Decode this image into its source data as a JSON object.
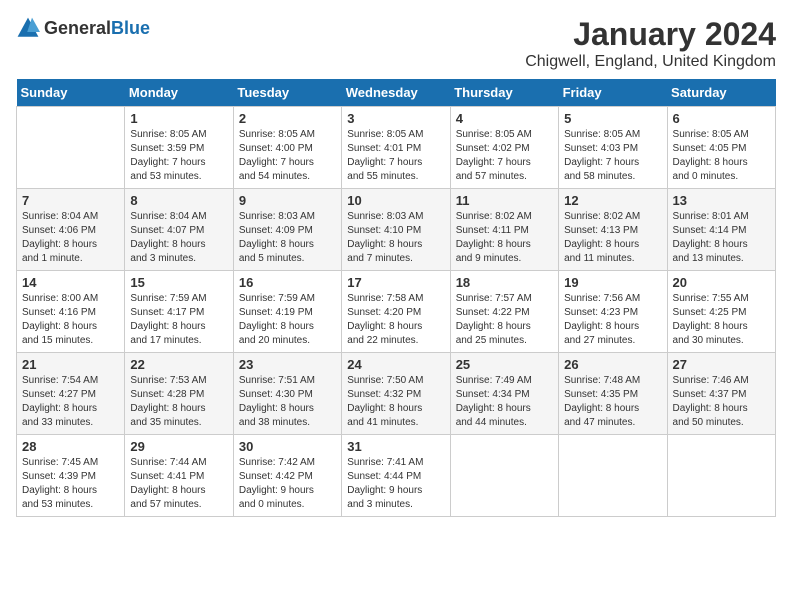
{
  "header": {
    "logo_general": "General",
    "logo_blue": "Blue",
    "title": "January 2024",
    "location": "Chigwell, England, United Kingdom"
  },
  "columns": [
    "Sunday",
    "Monday",
    "Tuesday",
    "Wednesday",
    "Thursday",
    "Friday",
    "Saturday"
  ],
  "weeks": [
    {
      "days": [
        {
          "num": "",
          "info": ""
        },
        {
          "num": "1",
          "info": "Sunrise: 8:05 AM\nSunset: 3:59 PM\nDaylight: 7 hours\nand 53 minutes."
        },
        {
          "num": "2",
          "info": "Sunrise: 8:05 AM\nSunset: 4:00 PM\nDaylight: 7 hours\nand 54 minutes."
        },
        {
          "num": "3",
          "info": "Sunrise: 8:05 AM\nSunset: 4:01 PM\nDaylight: 7 hours\nand 55 minutes."
        },
        {
          "num": "4",
          "info": "Sunrise: 8:05 AM\nSunset: 4:02 PM\nDaylight: 7 hours\nand 57 minutes."
        },
        {
          "num": "5",
          "info": "Sunrise: 8:05 AM\nSunset: 4:03 PM\nDaylight: 7 hours\nand 58 minutes."
        },
        {
          "num": "6",
          "info": "Sunrise: 8:05 AM\nSunset: 4:05 PM\nDaylight: 8 hours\nand 0 minutes."
        }
      ]
    },
    {
      "days": [
        {
          "num": "7",
          "info": "Sunrise: 8:04 AM\nSunset: 4:06 PM\nDaylight: 8 hours\nand 1 minute."
        },
        {
          "num": "8",
          "info": "Sunrise: 8:04 AM\nSunset: 4:07 PM\nDaylight: 8 hours\nand 3 minutes."
        },
        {
          "num": "9",
          "info": "Sunrise: 8:03 AM\nSunset: 4:09 PM\nDaylight: 8 hours\nand 5 minutes."
        },
        {
          "num": "10",
          "info": "Sunrise: 8:03 AM\nSunset: 4:10 PM\nDaylight: 8 hours\nand 7 minutes."
        },
        {
          "num": "11",
          "info": "Sunrise: 8:02 AM\nSunset: 4:11 PM\nDaylight: 8 hours\nand 9 minutes."
        },
        {
          "num": "12",
          "info": "Sunrise: 8:02 AM\nSunset: 4:13 PM\nDaylight: 8 hours\nand 11 minutes."
        },
        {
          "num": "13",
          "info": "Sunrise: 8:01 AM\nSunset: 4:14 PM\nDaylight: 8 hours\nand 13 minutes."
        }
      ]
    },
    {
      "days": [
        {
          "num": "14",
          "info": "Sunrise: 8:00 AM\nSunset: 4:16 PM\nDaylight: 8 hours\nand 15 minutes."
        },
        {
          "num": "15",
          "info": "Sunrise: 7:59 AM\nSunset: 4:17 PM\nDaylight: 8 hours\nand 17 minutes."
        },
        {
          "num": "16",
          "info": "Sunrise: 7:59 AM\nSunset: 4:19 PM\nDaylight: 8 hours\nand 20 minutes."
        },
        {
          "num": "17",
          "info": "Sunrise: 7:58 AM\nSunset: 4:20 PM\nDaylight: 8 hours\nand 22 minutes."
        },
        {
          "num": "18",
          "info": "Sunrise: 7:57 AM\nSunset: 4:22 PM\nDaylight: 8 hours\nand 25 minutes."
        },
        {
          "num": "19",
          "info": "Sunrise: 7:56 AM\nSunset: 4:23 PM\nDaylight: 8 hours\nand 27 minutes."
        },
        {
          "num": "20",
          "info": "Sunrise: 7:55 AM\nSunset: 4:25 PM\nDaylight: 8 hours\nand 30 minutes."
        }
      ]
    },
    {
      "days": [
        {
          "num": "21",
          "info": "Sunrise: 7:54 AM\nSunset: 4:27 PM\nDaylight: 8 hours\nand 33 minutes."
        },
        {
          "num": "22",
          "info": "Sunrise: 7:53 AM\nSunset: 4:28 PM\nDaylight: 8 hours\nand 35 minutes."
        },
        {
          "num": "23",
          "info": "Sunrise: 7:51 AM\nSunset: 4:30 PM\nDaylight: 8 hours\nand 38 minutes."
        },
        {
          "num": "24",
          "info": "Sunrise: 7:50 AM\nSunset: 4:32 PM\nDaylight: 8 hours\nand 41 minutes."
        },
        {
          "num": "25",
          "info": "Sunrise: 7:49 AM\nSunset: 4:34 PM\nDaylight: 8 hours\nand 44 minutes."
        },
        {
          "num": "26",
          "info": "Sunrise: 7:48 AM\nSunset: 4:35 PM\nDaylight: 8 hours\nand 47 minutes."
        },
        {
          "num": "27",
          "info": "Sunrise: 7:46 AM\nSunset: 4:37 PM\nDaylight: 8 hours\nand 50 minutes."
        }
      ]
    },
    {
      "days": [
        {
          "num": "28",
          "info": "Sunrise: 7:45 AM\nSunset: 4:39 PM\nDaylight: 8 hours\nand 53 minutes."
        },
        {
          "num": "29",
          "info": "Sunrise: 7:44 AM\nSunset: 4:41 PM\nDaylight: 8 hours\nand 57 minutes."
        },
        {
          "num": "30",
          "info": "Sunrise: 7:42 AM\nSunset: 4:42 PM\nDaylight: 9 hours\nand 0 minutes."
        },
        {
          "num": "31",
          "info": "Sunrise: 7:41 AM\nSunset: 4:44 PM\nDaylight: 9 hours\nand 3 minutes."
        },
        {
          "num": "",
          "info": ""
        },
        {
          "num": "",
          "info": ""
        },
        {
          "num": "",
          "info": ""
        }
      ]
    }
  ]
}
